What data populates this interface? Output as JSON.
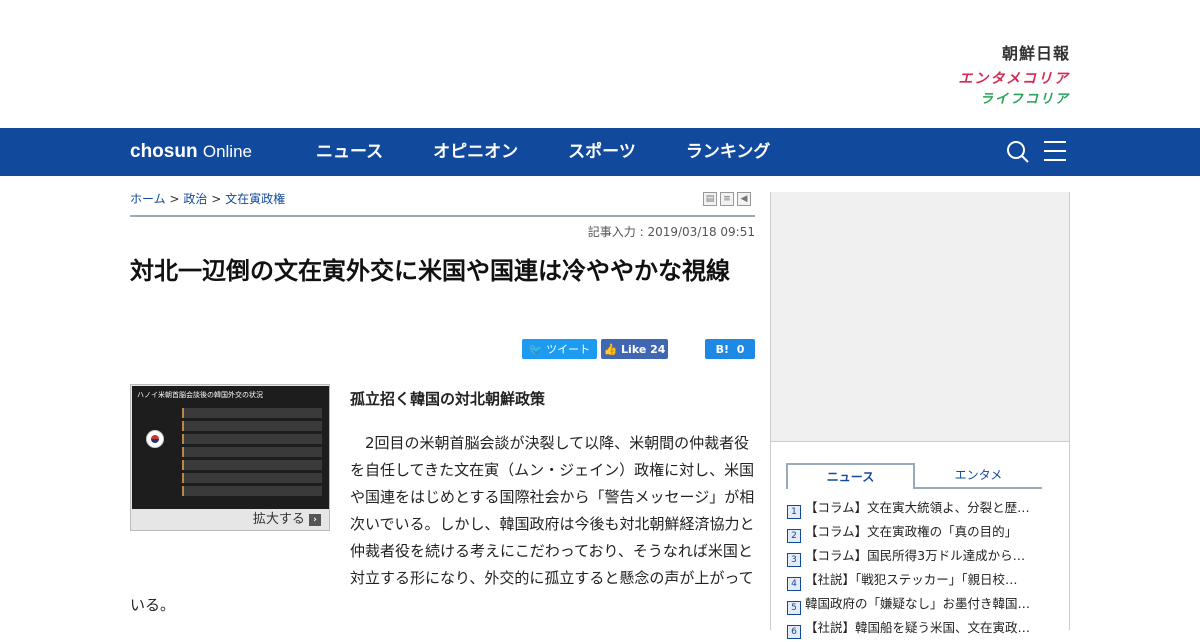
{
  "header": {
    "brand1": "朝鮮日報",
    "brand2": "エンタメコリア",
    "brand3": "ライフコリア"
  },
  "nav": {
    "logo_bold": "chosun",
    "logo_light": "Online",
    "items": [
      "ニュース",
      "オピニオン",
      "スポーツ",
      "ランキング"
    ]
  },
  "breadcrumb": {
    "home": "ホーム",
    "sep": ">",
    "section": "政治",
    "topic": "文在寅政権"
  },
  "article": {
    "date": "記事入力 : 2019/03/18 09:51",
    "title": "対北一辺倒の文在寅外交に米国や国連は冷ややかな視線",
    "tweet": "ツイート",
    "like": "Like",
    "like_count": "24",
    "hatena": "B!",
    "hatena_count": "0",
    "photo_caption": "ハノイ米朝首脳会談後の韓国外交の状況",
    "photo_button": "拡大する",
    "subhead": "孤立招く韓国の対北朝鮮政策",
    "body": "　2回目の米朝首脳会談が決裂して以降、米朝間の仲裁者役を自任してきた文在寅（ムン・ジェイン）政権に対し、米国や国連をはじめとする国際社会から「警告メッセージ」が相次いでいる。しかし、韓国政府は今後も対北朝鮮経済協力と仲裁者役を続ける考えにこだわっており、そうなれば米国と対立する形になり、外交的に孤立すると懸念の声が上がっている。"
  },
  "sidebar": {
    "tabs": [
      "ニュース",
      "エンタメ"
    ],
    "items": [
      "【コラム】文在寅大統領よ、分裂と歴…",
      "【コラム】文在寅政権の「真の目的」",
      "【コラム】国民所得3万ドル達成から…",
      "【社説】「戦犯ステッカー」「親日校…",
      "韓国政府の「嫌疑なし」お墨付き韓国…",
      "【社説】韓国船を疑う米国、文在寅政…"
    ]
  }
}
